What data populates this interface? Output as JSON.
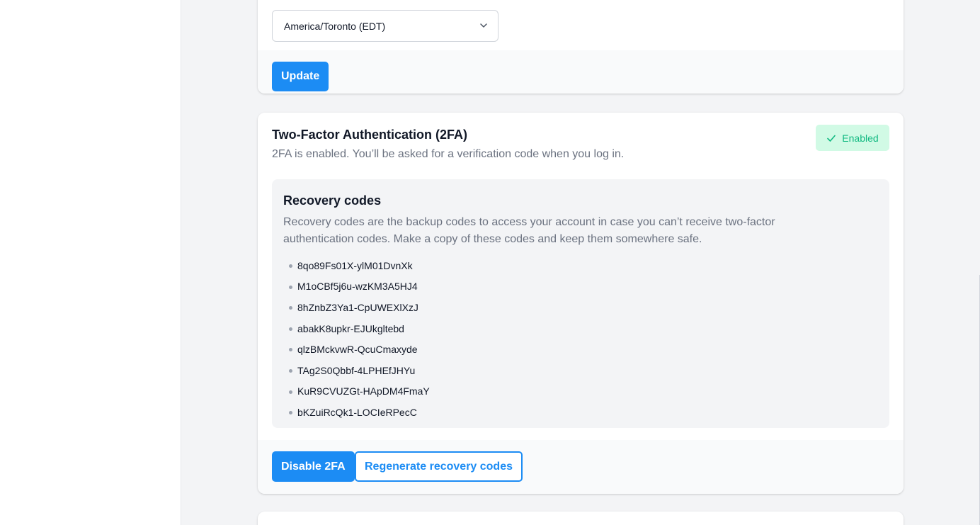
{
  "timezone": {
    "selected": "America/Toronto (EDT)",
    "update_label": "Update"
  },
  "twofa": {
    "title": "Two-Factor Authentication (2FA)",
    "description": "2FA is enabled. You’ll be asked for a verification code when you log in.",
    "badge": "Enabled",
    "recovery": {
      "title": "Recovery codes",
      "description": "Recovery codes are the backup codes to access your account in case you can’t receive two-factor authentication codes. Make a copy of these codes and keep them somewhere safe.",
      "codes": [
        "8qo89Fs01X-ylM01DvnXk",
        "M1oCBf5j6u-wzKM3A5HJ4",
        "8hZnbZ3Ya1-CpUWEXlXzJ",
        "abakK8upkr-EJUkgltebd",
        "qlzBMckvwR-QcuCmaxyde",
        "TAg2S0Qbbf-4LPHEfJHYu",
        "KuR9CVUZGt-HApDM4FmaY",
        "bKZuiRcQk1-LOCIeRPecC"
      ]
    },
    "disable_label": "Disable 2FA",
    "regenerate_label": "Regenerate recovery codes"
  },
  "icons": {
    "select_chevron": "chevron-down-icon",
    "badge_check": "check-icon"
  },
  "colors": {
    "primary": "#1c8cf4",
    "success_bg": "#d1fae5",
    "success_text": "#10b981"
  }
}
